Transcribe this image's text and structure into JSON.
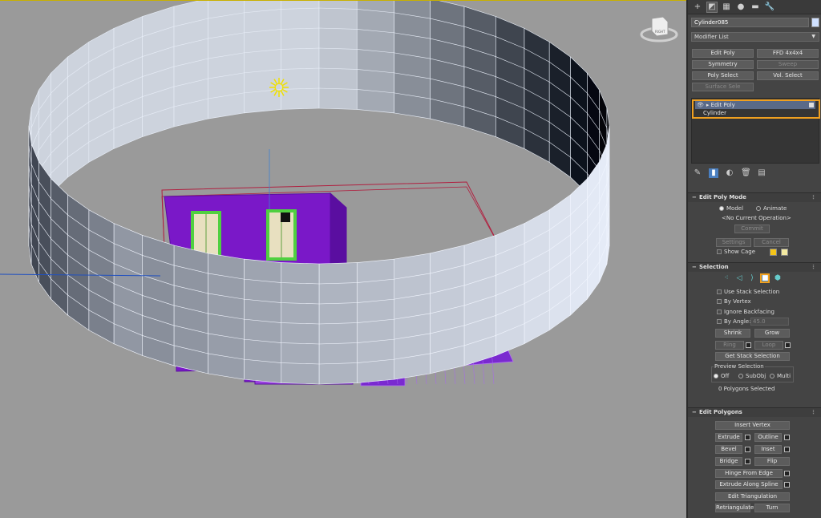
{
  "panel": {
    "tabs": [
      {
        "name": "create-tab",
        "glyph": "+"
      },
      {
        "name": "modify-tab",
        "glyph": "◩"
      },
      {
        "name": "hierarchy-tab",
        "glyph": "▦"
      },
      {
        "name": "motion-tab",
        "glyph": "●"
      },
      {
        "name": "display-tab",
        "glyph": "▬"
      },
      {
        "name": "utilities-tab",
        "glyph": "🔧"
      }
    ],
    "object_name": "Cylinder085",
    "object_color": "#cfe0ff",
    "modifier_list": "Modifier List",
    "modifier_buttons": {
      "edit_poly": "Edit Poly",
      "ffd": "FFD 4x4x4",
      "symmetry": "Symmetry",
      "sweep": "Sweep",
      "poly_select": "Poly Select",
      "vol_select": "Vol. Select",
      "surface_sele": "Surface Sele"
    },
    "stack": {
      "top": "Edit Poly",
      "base": "Cylinder"
    },
    "edit_poly_mode": {
      "title": "Edit Poly Mode",
      "model": "Model",
      "animate": "Animate",
      "current_operation": "<No Current Operation>",
      "commit": "Commit",
      "settings": "Settings",
      "cancel": "Cancel",
      "show_cage": "Show Cage",
      "cage_color_1": "#f5c518",
      "cage_color_2": "#f3e9a0"
    },
    "selection": {
      "title": "Selection",
      "use_stack_selection": "Use Stack Selection",
      "by_vertex": "By Vertex",
      "ignore_backfacing": "Ignore Backfacing",
      "by_angle": "By Angle:",
      "angle_value": "45.0",
      "shrink": "Shrink",
      "grow": "Grow",
      "ring": "Ring",
      "loop": "Loop",
      "get_stack_selection": "Get Stack Selection",
      "preview_selection": "Preview Selection",
      "off": "Off",
      "subobj": "SubObj",
      "multi": "Multi",
      "status": "0 Polygons Selected"
    },
    "edit_polygons": {
      "title": "Edit Polygons",
      "insert_vertex": "Insert Vertex",
      "extrude": "Extrude",
      "outline": "Outline",
      "bevel": "Bevel",
      "inset": "Inset",
      "bridge": "Bridge",
      "flip": "Flip",
      "hinge_from_edge": "Hinge From Edge",
      "extrude_along_spline": "Extrude Along Spline",
      "edit_triangulation": "Edit Triangulation",
      "retriangulate": "Retriangulate",
      "turn": "Turn"
    },
    "accent_color": "#f0a020"
  },
  "viewport": {
    "viewcube_label": "RIGHT",
    "background": "#9a9a9a",
    "house_color": "#7a18c8"
  }
}
